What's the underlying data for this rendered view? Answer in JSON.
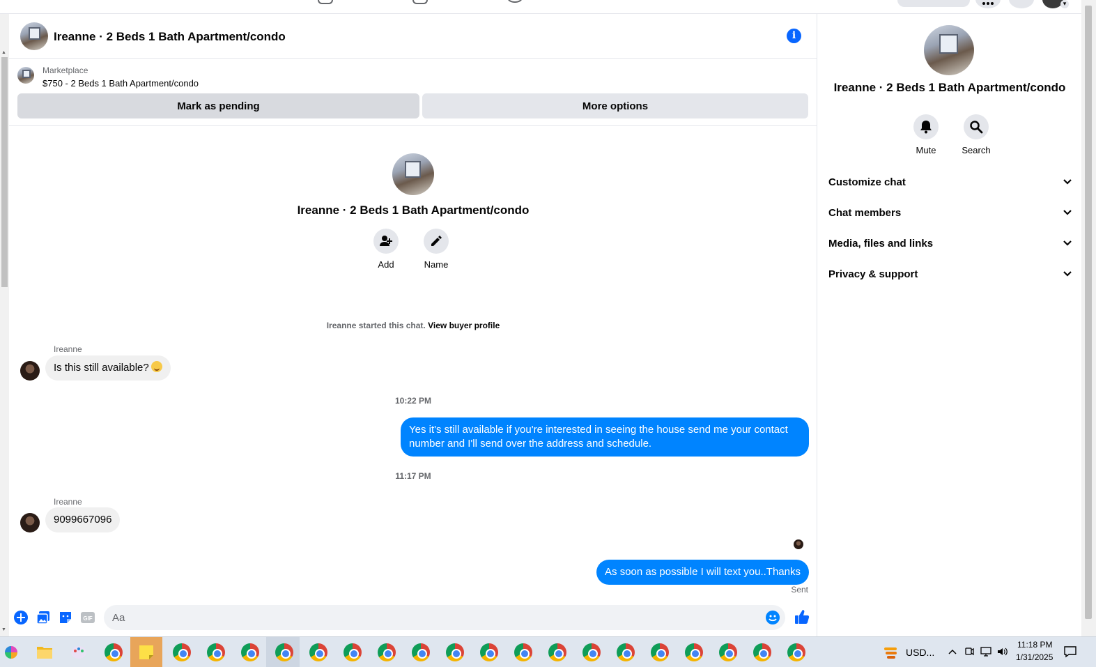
{
  "header": {
    "title": "Ireanne · 2 Beds 1 Bath Apartment/condo"
  },
  "marketplace": {
    "label": "Marketplace",
    "price_line": "$750 - 2 Beds 1 Bath Apartment/condo",
    "mark_pending_label": "Mark as pending",
    "more_options_label": "More options"
  },
  "intro": {
    "title": "Ireanne · 2 Beds 1 Bath Apartment/condo",
    "add_label": "Add",
    "name_label": "Name"
  },
  "system": {
    "started_text": "Ireanne started this chat.",
    "view_profile_label": "View buyer profile"
  },
  "messages": [
    {
      "sender": "Ireanne",
      "text": "Is this still available?"
    },
    {
      "timestamp": "10:22 PM"
    },
    {
      "text": "Yes it's still available if you're interested in seeing the house send me your contact number and I'll send over the address and schedule."
    },
    {
      "timestamp": "11:17 PM"
    },
    {
      "sender": "Ireanne",
      "text": "9099667096"
    },
    {
      "text": "As soon as possible I will text you..Thanks",
      "status": "Sent"
    }
  ],
  "composer": {
    "placeholder": "Aa"
  },
  "right_panel": {
    "title": "Ireanne · 2 Beds 1 Bath Apartment/condo",
    "mute_label": "Mute",
    "search_label": "Search",
    "sections": [
      {
        "label": "Customize chat"
      },
      {
        "label": "Chat members"
      },
      {
        "label": "Media, files and links"
      },
      {
        "label": "Privacy & support"
      }
    ]
  },
  "taskbar": {
    "weather_text": "USD...",
    "time": "11:18 PM",
    "date": "1/31/2025"
  },
  "colors": {
    "accent": "#0084ff",
    "messenger_blue": "#0866ff",
    "bubble_in": "#f0f0f0",
    "secondary_text": "#65676b"
  },
  "icons": [
    "info-icon",
    "add-person-icon",
    "pencil-icon",
    "bell-icon",
    "search-icon",
    "chevron-down-icon",
    "plus-icon",
    "photo-icon",
    "sticker-icon",
    "gif-icon",
    "emoji-icon",
    "thumbs-up-icon",
    "chrome-icon",
    "windows-icon",
    "file-explorer-icon",
    "sticky-notes-icon",
    "notification-icon"
  ]
}
